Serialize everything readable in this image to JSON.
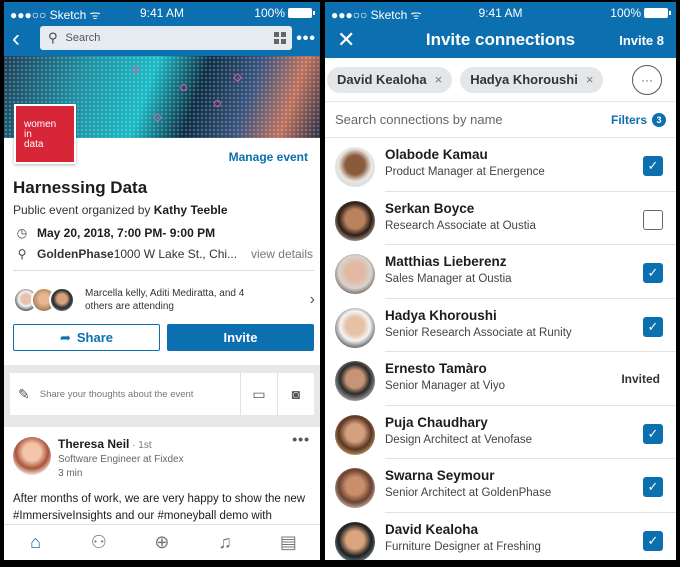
{
  "left": {
    "status": {
      "carrier": "●●●○○ Sketch ᯤ",
      "time": "9:41 AM",
      "battery": "100%"
    },
    "topbar": {
      "back_icon": "‹",
      "search_placeholder": "Search",
      "search_icon": "⚲",
      "more_icon": "•••"
    },
    "event": {
      "logo_text": [
        "women",
        "in",
        "data"
      ],
      "manage_label": "Manage event",
      "title": "Harnessing Data",
      "organizer_prefix": "Public event organized by ",
      "organizer_name": "Kathy Teeble",
      "datetime": "May 20, 2018, 7:00 PM- 9:00 PM",
      "venue_name": "GoldenPhase",
      "venue_address": " 1000 W Lake St., Chi...",
      "view_details": "view details",
      "clock_icon": "◷",
      "pin_icon": "⚲"
    },
    "attendees": {
      "text": "Marcella kelly, Aditi Mediratta, and 4 others are attending",
      "chevron": "›"
    },
    "actions": {
      "share_label": "Share",
      "share_icon": "➦",
      "invite_label": "Invite"
    },
    "composer": {
      "placeholder": "Share your thoughts about the event",
      "pen_icon": "✎",
      "video_icon": "▭",
      "camera_icon": "◙"
    },
    "post": {
      "author": "Theresa Neil",
      "degree": " · 1st",
      "role": "Software Engineer at Fixdex",
      "time": "3 min",
      "more_icon": "•••",
      "body": "After months of work, we are very happy to show the new #ImmersiveInsights and our #moneyball demo with"
    },
    "tabs": [
      {
        "name": "home",
        "icon": "⌂"
      },
      {
        "name": "network",
        "icon": "⚇"
      },
      {
        "name": "post",
        "icon": "⊕"
      },
      {
        "name": "notifications",
        "icon": "♫"
      },
      {
        "name": "jobs",
        "icon": "▤"
      }
    ]
  },
  "right": {
    "status": {
      "carrier": "●●●○○ Sketch ᯤ",
      "time": "9:41 AM",
      "battery": "100%"
    },
    "header": {
      "close_icon": "✕",
      "title": "Invite connections",
      "invite_label": "Invite 8"
    },
    "chips": [
      {
        "label": "David Kealoha",
        "remove": "×"
      },
      {
        "label": "Hadya Khoroushi",
        "remove": "×"
      }
    ],
    "chip_more": "···",
    "search": {
      "placeholder": "Search connections by name",
      "filters_label": "Filters",
      "filters_count": "3"
    },
    "connections": [
      {
        "name": "Olabode Kamau",
        "role": "Product Manager at Energence",
        "state": "checked"
      },
      {
        "name": "Serkan Boyce",
        "role": "Research Associate at Oustia",
        "state": "unchecked"
      },
      {
        "name": "Matthias Lieberenz",
        "role": "Sales Manager at Oustia",
        "state": "checked"
      },
      {
        "name": "Hadya Khoroushi",
        "role": "Senior Research Associate at Runity",
        "state": "checked"
      },
      {
        "name": "Ernesto Tamàro",
        "role": "Senior Manager at Viyo",
        "state": "invited",
        "invited_label": "Invited"
      },
      {
        "name": "Puja Chaudhary",
        "role": "Design Architect at Venofase",
        "state": "checked"
      },
      {
        "name": "Swarna Seymour",
        "role": "Senior Architect at GoldenPhase",
        "state": "checked"
      },
      {
        "name": "David Kealoha",
        "role": "Furniture Designer at Freshing",
        "state": "checked"
      }
    ],
    "check_icon": "✓"
  },
  "colors": {
    "brand": "#0c6fb0",
    "logo_red": "#d62638"
  }
}
